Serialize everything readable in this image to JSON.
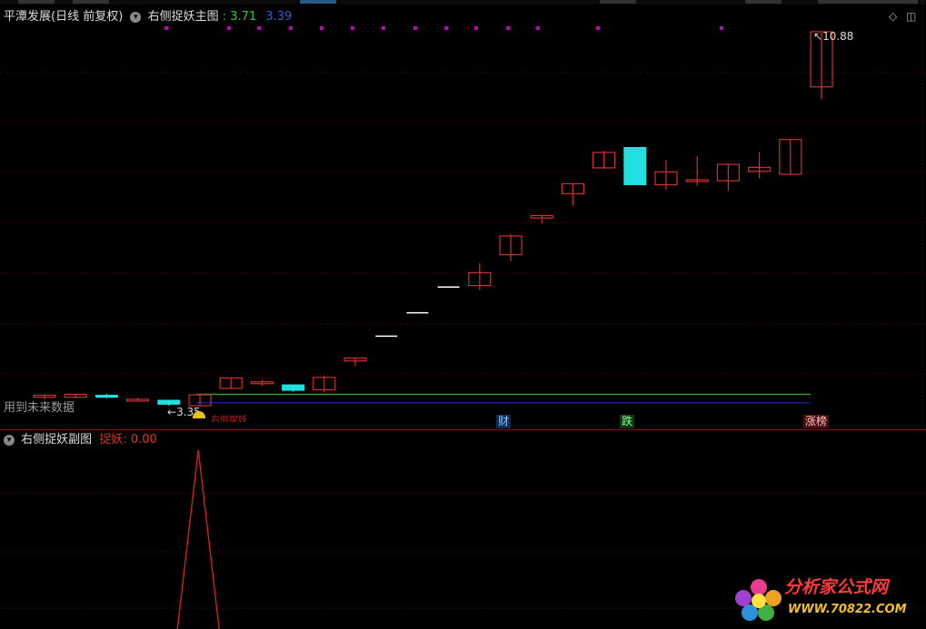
{
  "main": {
    "stock_title": "平潭发展(日线 前复权)",
    "indicator_name": "右侧捉妖主图",
    "val1": ": 3.71",
    "val2": "3.39",
    "high_label": "10.88",
    "low_label": "3.35",
    "future_note": "用到未来数据",
    "overlay_text": "右侧捉妖",
    "tags": {
      "cai": "财",
      "die": "跌",
      "zhangbang": "涨榜"
    },
    "colors": {
      "up": "#d03030",
      "down": "#22e0e0",
      "green_line": "#2ea82e",
      "blue_line": "#2020b0",
      "dot": "#c000c0"
    }
  },
  "sub": {
    "indicator_name": "右侧捉妖副图",
    "series_label": "捉妖",
    "series_value": ": 0.00"
  },
  "watermark": {
    "name": "分析家公式网",
    "url": "WWW.70822.COM"
  },
  "chart_data": {
    "type": "candlestick",
    "candles": [
      {
        "open": 3.52,
        "close": 3.56,
        "high": 3.58,
        "low": 3.48
      },
      {
        "open": 3.52,
        "close": 3.58,
        "high": 3.58,
        "low": 3.5
      },
      {
        "open": 3.56,
        "close": 3.52,
        "high": 3.59,
        "low": 3.5
      },
      {
        "open": 3.48,
        "close": 3.48,
        "high": 3.51,
        "low": 3.46
      },
      {
        "open": 3.46,
        "close": 3.38,
        "high": 3.46,
        "low": 3.35
      },
      {
        "open": 3.35,
        "close": 3.57,
        "high": 3.57,
        "low": 3.35
      },
      {
        "open": 3.7,
        "close": 3.91,
        "high": 3.91,
        "low": 3.7
      },
      {
        "open": 3.8,
        "close": 3.83,
        "high": 3.87,
        "low": 3.75
      },
      {
        "open": 3.77,
        "close": 3.66,
        "high": 3.78,
        "low": 3.63
      },
      {
        "open": 3.67,
        "close": 3.92,
        "high": 3.95,
        "low": 3.62
      },
      {
        "open": 4.25,
        "close": 4.31,
        "high": 4.31,
        "low": 4.15
      },
      {
        "open": 4.75,
        "close": 4.75,
        "high": 4.75,
        "low": 4.75
      },
      {
        "open": 5.22,
        "close": 5.22,
        "high": 5.22,
        "low": 5.22
      },
      {
        "open": 5.74,
        "close": 5.74,
        "high": 5.74,
        "low": 5.74
      },
      {
        "open": 5.77,
        "close": 6.03,
        "high": 6.22,
        "low": 5.68
      },
      {
        "open": 6.39,
        "close": 6.77,
        "high": 6.8,
        "low": 6.26
      },
      {
        "open": 7.13,
        "close": 7.18,
        "high": 7.18,
        "low": 7.02
      },
      {
        "open": 7.62,
        "close": 7.82,
        "high": 7.82,
        "low": 7.38
      },
      {
        "open": 8.14,
        "close": 8.45,
        "high": 8.48,
        "low": 8.12
      },
      {
        "open": 8.55,
        "close": 7.8,
        "high": 8.55,
        "low": 7.8
      },
      {
        "open": 7.8,
        "close": 8.06,
        "high": 8.3,
        "low": 7.7
      },
      {
        "open": 7.88,
        "close": 7.9,
        "high": 8.38,
        "low": 7.78
      },
      {
        "open": 7.88,
        "close": 8.21,
        "high": 8.21,
        "low": 7.68
      },
      {
        "open": 8.07,
        "close": 8.15,
        "high": 8.46,
        "low": 7.93
      },
      {
        "open": 8.01,
        "close": 8.71,
        "high": 8.71,
        "low": 8.01
      },
      {
        "open": 9.77,
        "close": 10.88,
        "high": 10.88,
        "low": 9.52
      }
    ],
    "green_line": 3.58,
    "blue_line": 3.41,
    "sub_series": {
      "name": "捉妖",
      "spike_index": 6
    }
  }
}
